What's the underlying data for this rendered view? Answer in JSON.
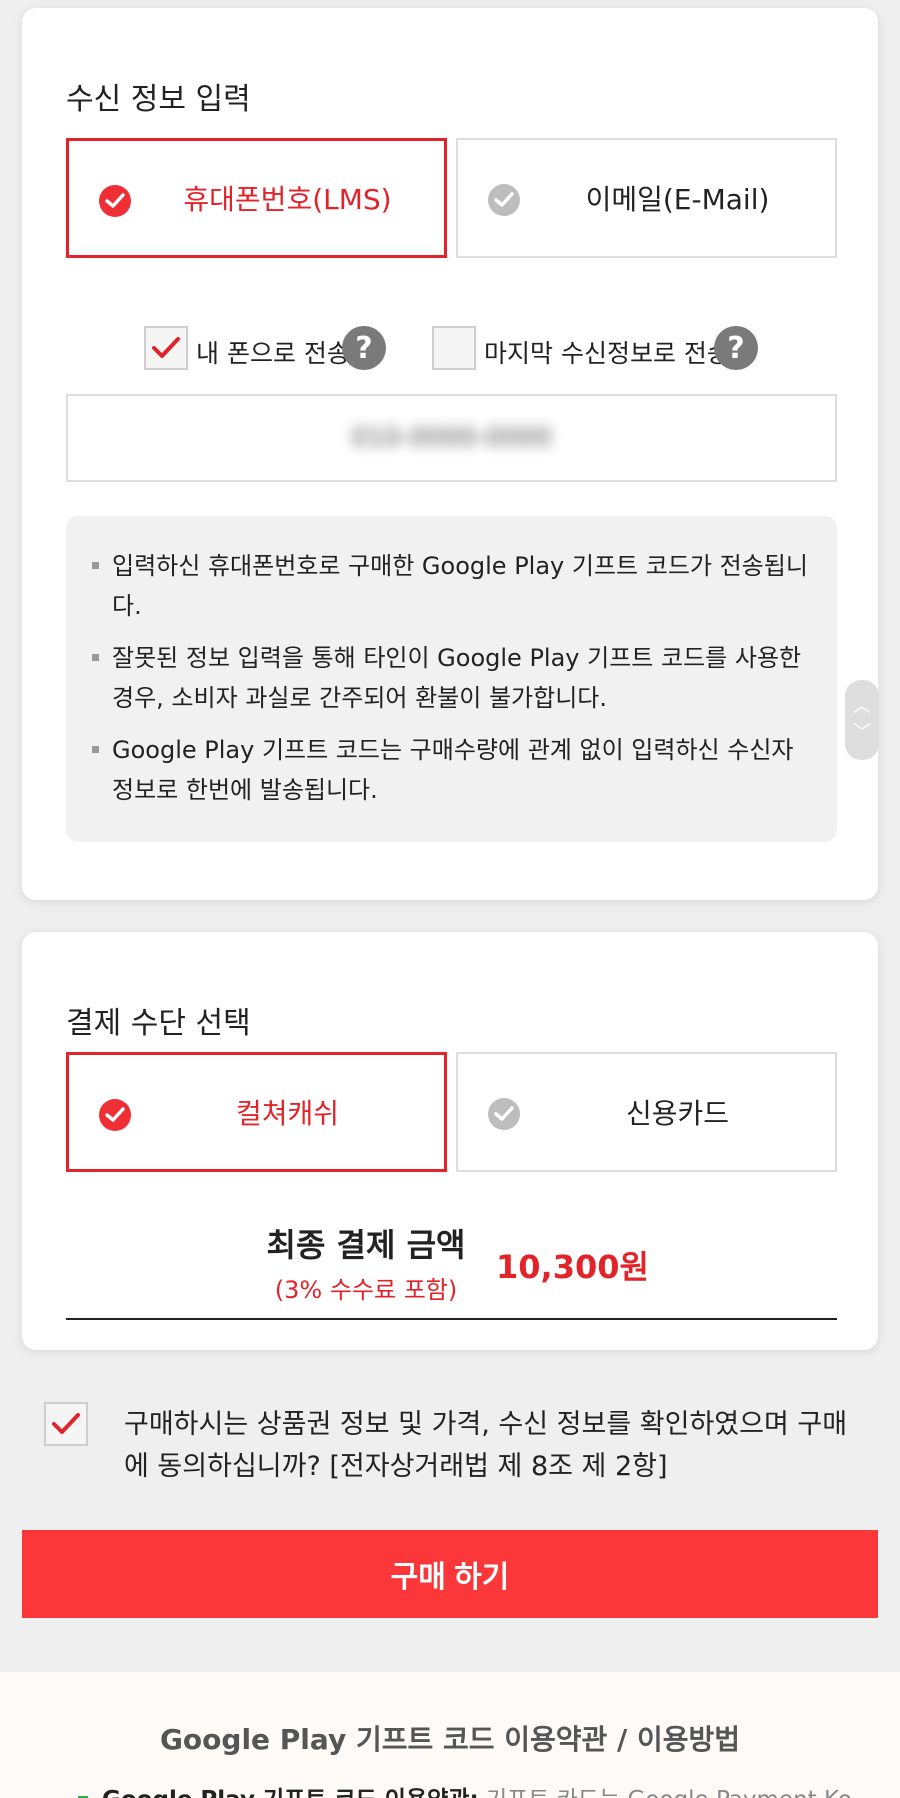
{
  "receive": {
    "title": "수신 정보 입력",
    "options": [
      {
        "label": "휴대폰번호(LMS)",
        "selected": true
      },
      {
        "label": "이메일(E-Mail)",
        "selected": false
      }
    ],
    "checkboxes": [
      {
        "label": "내 폰으로 전송",
        "checked": true
      },
      {
        "label": "마지막 수신정보로 전송",
        "checked": false
      }
    ],
    "phone_value": "010-0000-0000",
    "notices": [
      "입력하신 휴대폰번호로 구매한 Google Play 기프트 코드가 전송됩니다.",
      "잘못된 정보 입력을 통해 타인이 Google Play 기프트 코드를 사용한 경우, 소비자 과실로 간주되어 환불이 불가합니다.",
      "Google Play 기프트 코드는 구매수량에 관계 없이 입력하신 수신자정보로 한번에 발송됩니다."
    ]
  },
  "payment": {
    "title": "결제 수단 선택",
    "options": [
      {
        "label": "컬쳐캐쉬",
        "selected": true
      },
      {
        "label": "신용카드",
        "selected": false
      }
    ],
    "total_label": "최종 결제 금액",
    "fee_note": "(3% 수수료 포함)",
    "total_amount": "10,300원"
  },
  "agreement": {
    "checked": true,
    "text": "구매하시는 상품권 정보 및 가격, 수신 정보를 확인하였으며 구매에 동의하십니까? [전자상거래법 제 8조 제 2항]"
  },
  "buy_button": "구매 하기",
  "footer": {
    "title": "Google Play 기프트 코드 이용약관 / 이용방법",
    "line_bold": "Google Play 기프트 코드 이용약관:",
    "line_rest": " 기프트 카드는 Google Payment Ko"
  },
  "colors": {
    "accent": "#e2232a",
    "button": "#fb373a",
    "background": "#efefef"
  },
  "icons": {
    "check": "check-circle-icon",
    "help": "question-mark-icon"
  }
}
